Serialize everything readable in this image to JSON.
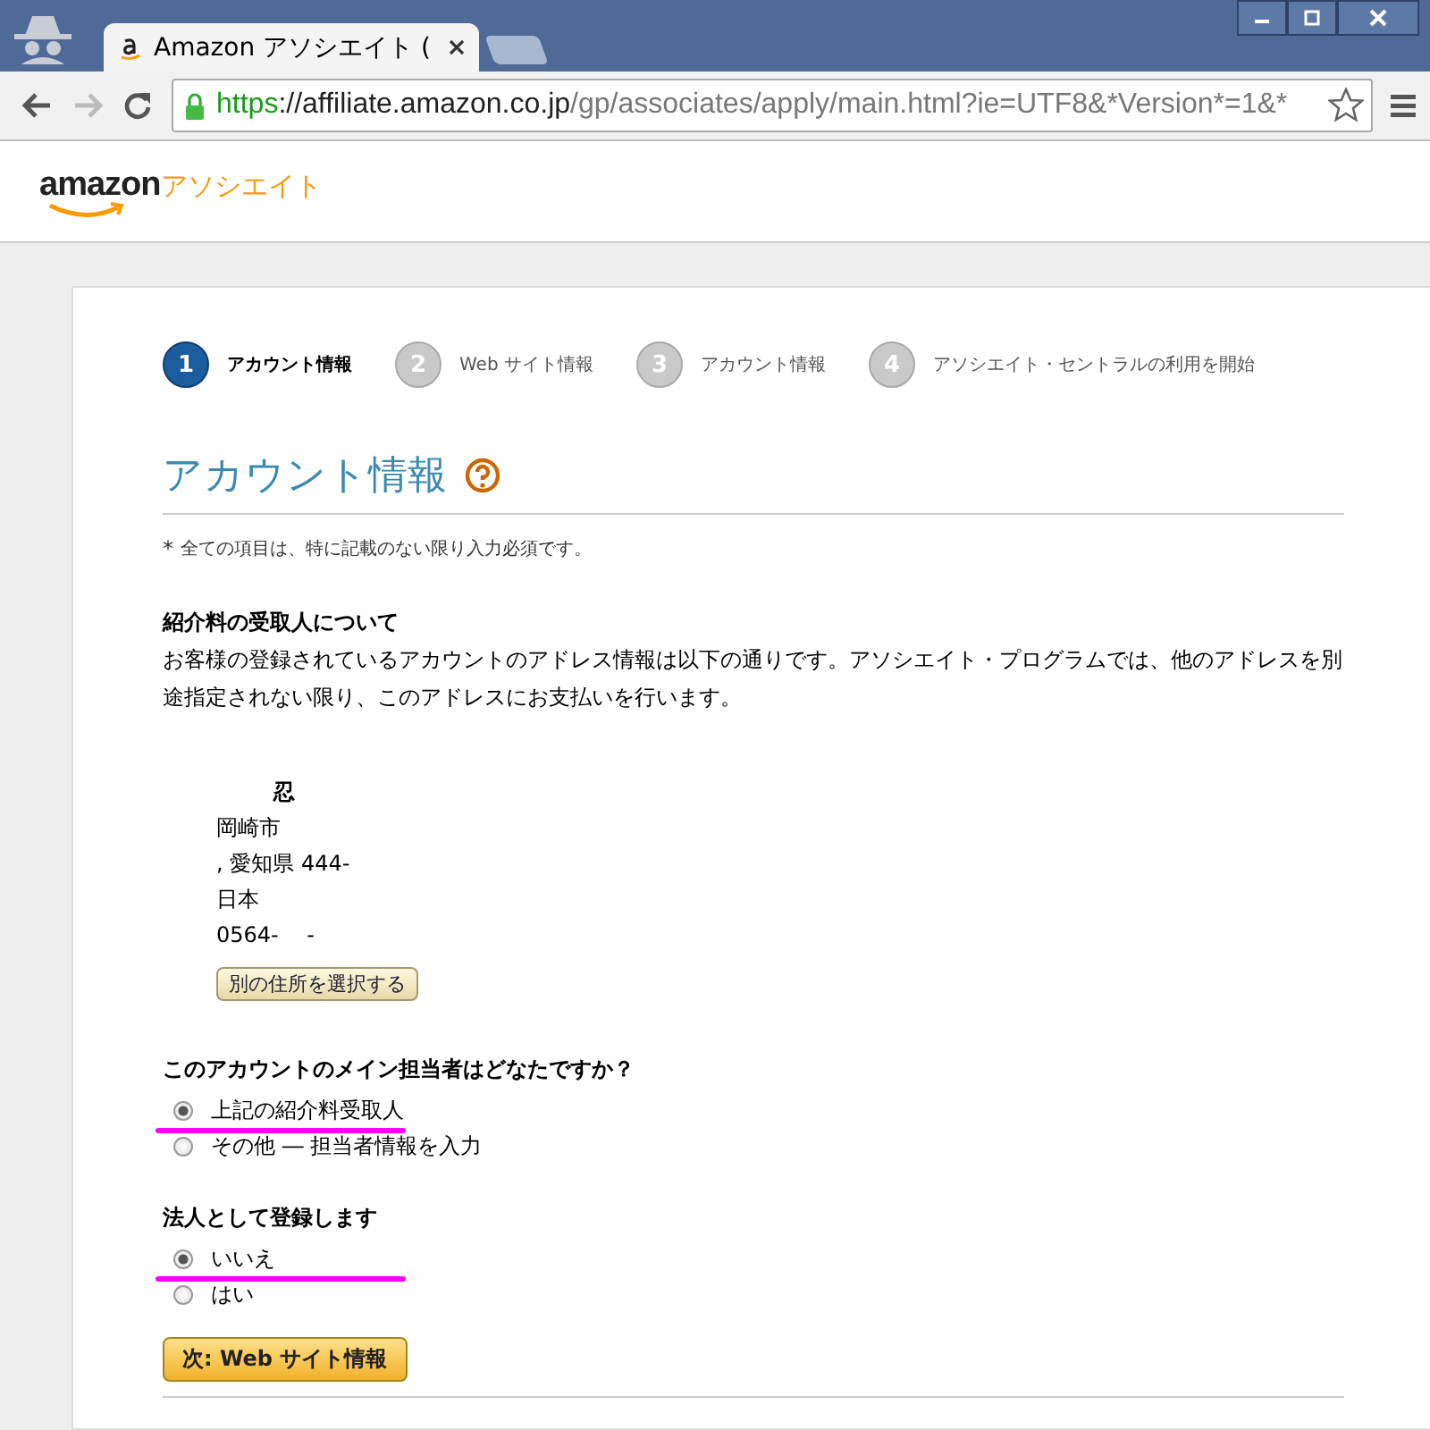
{
  "window": {
    "tab_title": "Amazon アソシエイト (",
    "url_scheme": "https",
    "url_host": "://affiliate.amazon.co.jp",
    "url_path": "/gp/associates/apply/main.html?ie=UTF8&*Version*=1&*"
  },
  "header": {
    "logo_word": "amazon",
    "logo_suffix": "アソシエイト"
  },
  "steps": [
    {
      "number": "1",
      "label": "アカウント情報",
      "selected": true
    },
    {
      "number": "2",
      "label": "Web サイト情報",
      "selected": false
    },
    {
      "number": "3",
      "label": "アカウント情報",
      "selected": false
    },
    {
      "number": "4",
      "label": "アソシエイト・セントラルの利用を開始",
      "selected": false
    }
  ],
  "page_title": "アカウント情報",
  "required_note_mark": "*",
  "required_note": "全ての項目は、特に記載のない限り入力必須です。",
  "payee": {
    "heading": "紹介料の受取人について",
    "description": "お客様の登録されているアカウントのアドレス情報は以下の通りです。アソシエイト・プログラムでは、他のアドレスを別途指定されない限り、このアドレスにお支払いを行います。",
    "name": "忍",
    "address_lines": [
      "岡崎市",
      ", 愛知県 444-",
      "日本",
      "0564-　 -"
    ],
    "change_button": "別の住所を選択する"
  },
  "questions": [
    {
      "heading": "このアカウントのメイン担当者はどなたですか？",
      "options": [
        {
          "label": "上記の紹介料受取人",
          "selected": true
        },
        {
          "label": "その他 ― 担当者情報を入力",
          "selected": false
        }
      ]
    },
    {
      "heading": "法人として登録します",
      "options": [
        {
          "label": "いいえ",
          "selected": true
        },
        {
          "label": "はい",
          "selected": false
        }
      ]
    }
  ],
  "next_button": "次: Web サイト情報"
}
